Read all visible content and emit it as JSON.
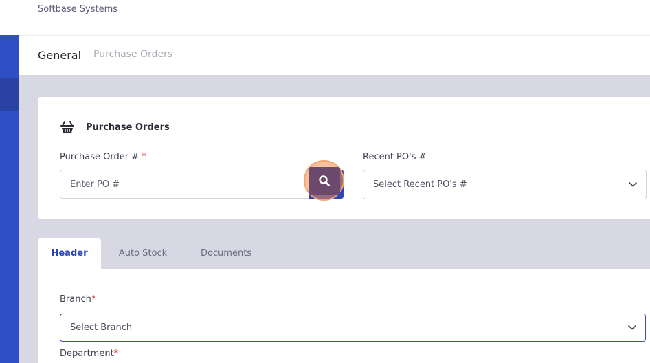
{
  "company": "Softbase Systems",
  "breadcrumb": {
    "general": "General",
    "current": "Purchase Orders"
  },
  "card": {
    "title": "Purchase Orders",
    "title_icon": "basket-icon",
    "po_label": "Purchase Order #",
    "required_mark": "*",
    "po_placeholder": "Enter PO #",
    "search_icon": "search-icon",
    "recent_label": "Recent PO's #",
    "recent_placeholder": "Select Recent PO's #"
  },
  "tabs": [
    {
      "label": "Header",
      "active": true
    },
    {
      "label": "Auto Stock",
      "active": false
    },
    {
      "label": "Documents",
      "active": false
    }
  ],
  "form": {
    "branch_label": "Branch",
    "branch_placeholder": "Select Branch",
    "department_label": "Department",
    "required_mark": "*"
  },
  "colors": {
    "sidebar": "#2f4fc4",
    "accent": "#2c46b8",
    "background": "#d7d8e4",
    "required": "#d9342b",
    "highlight": "#f4a46a"
  }
}
